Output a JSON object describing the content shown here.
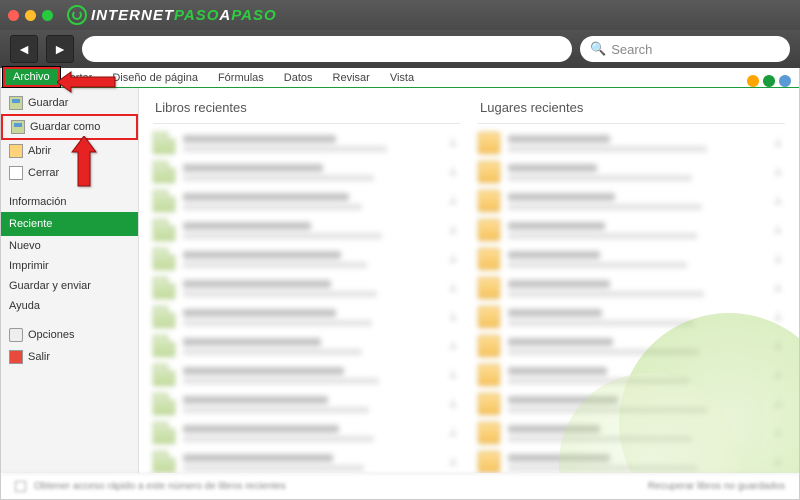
{
  "browser": {
    "logo_part1": "INTERNET",
    "logo_part2": "PASO",
    "logo_part3": "A",
    "logo_part4": "PASO",
    "search_placeholder": "Search"
  },
  "ribbon": {
    "file": "Archivo",
    "tabs": [
      "ertar",
      "Diseño de página",
      "Fórmulas",
      "Datos",
      "Revisar",
      "Vista"
    ]
  },
  "sidemenu": {
    "guardar": "Guardar",
    "guardar_como": "Guardar como",
    "abrir": "Abrir",
    "cerrar": "Cerrar",
    "informacion": "Información",
    "reciente": "Reciente",
    "nuevo": "Nuevo",
    "imprimir": "Imprimir",
    "guardar_enviar": "Guardar y enviar",
    "ayuda": "Ayuda",
    "opciones": "Opciones",
    "salir": "Salir"
  },
  "main": {
    "col1_header": "Libros recientes",
    "col2_header": "Lugares recientes",
    "footer_text": "Obtener acceso rápido a este número de libros recientes",
    "footer_right": "Recuperar libros no guardados"
  }
}
